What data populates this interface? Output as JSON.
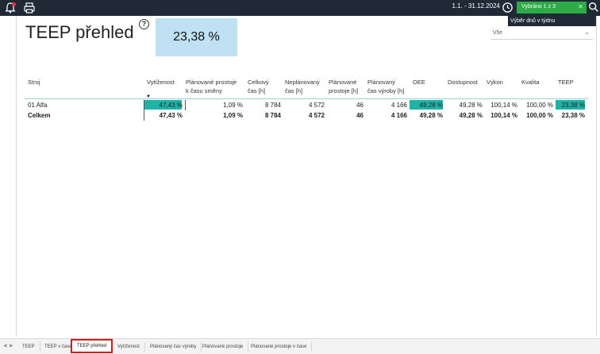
{
  "topbar": {
    "date_range": "1.1. - 31.12.2024",
    "filter_chip": "Vybráno 1 z 3",
    "tooltip": "Výběr dnů v týdnu"
  },
  "page": {
    "title": "TEEP přehled",
    "help": "?",
    "kpi_value": "23,38 %"
  },
  "filter": {
    "selected": "Vše"
  },
  "table": {
    "headers": {
      "machine": "Stroj",
      "utilization": "Vytíženost",
      "planned_downtime_1": "Plánované prostoje",
      "planned_downtime_2": "k času směny",
      "total_time_1": "Celkový",
      "total_time_2": "čas [h]",
      "unplanned_time_1": "Neplánovaný",
      "unplanned_time_2": "čas [h]",
      "planned_stops_1": "Plánované",
      "planned_stops_2": "prostoje [h]",
      "planned_prod_1": "Plánovaný",
      "planned_prod_2": "čas výroby [h]",
      "oee": "OEE",
      "availability": "Dostupnost",
      "performance": "Výkon",
      "quality": "Kvalita",
      "teep": "TEEP"
    },
    "rows": [
      {
        "machine": "01 Alfa",
        "utilization": "47,43 %",
        "planned_downtime": "1,09 %",
        "total_time": "8 784",
        "unplanned_time": "4 572",
        "planned_stops": "46",
        "planned_prod": "4 166",
        "oee": "49,28 %",
        "availability": "49,28 %",
        "performance": "100,14 %",
        "quality": "100,00 %",
        "teep": "23,38 %"
      }
    ],
    "total": {
      "machine": "Celkem",
      "utilization": "47,43 %",
      "planned_downtime": "1,09 %",
      "total_time": "8 784",
      "unplanned_time": "4 572",
      "planned_stops": "46",
      "planned_prod": "4 166",
      "oee": "49,28 %",
      "availability": "49,28 %",
      "performance": "100,14 %",
      "quality": "100,00 %",
      "teep": "23,38 %"
    },
    "bar_color": "#20b2a4",
    "bar_fraction": {
      "utilization": 0.4743,
      "oee": 0.4928,
      "teep": 0.2338
    }
  },
  "tabs": [
    {
      "label": "TEEP"
    },
    {
      "label": "TEEP v čase"
    },
    {
      "label": "TEEP přehled"
    },
    {
      "label": "Vytíženost"
    },
    {
      "label": "Plánovaný čas výroby"
    },
    {
      "label": "Plánované prostoje"
    },
    {
      "label": "Plánované prostoje v čase"
    }
  ],
  "icons": {
    "bell": "bell-alert-icon",
    "print": "print-icon",
    "clock": "clock-icon",
    "search": "search-icon"
  }
}
